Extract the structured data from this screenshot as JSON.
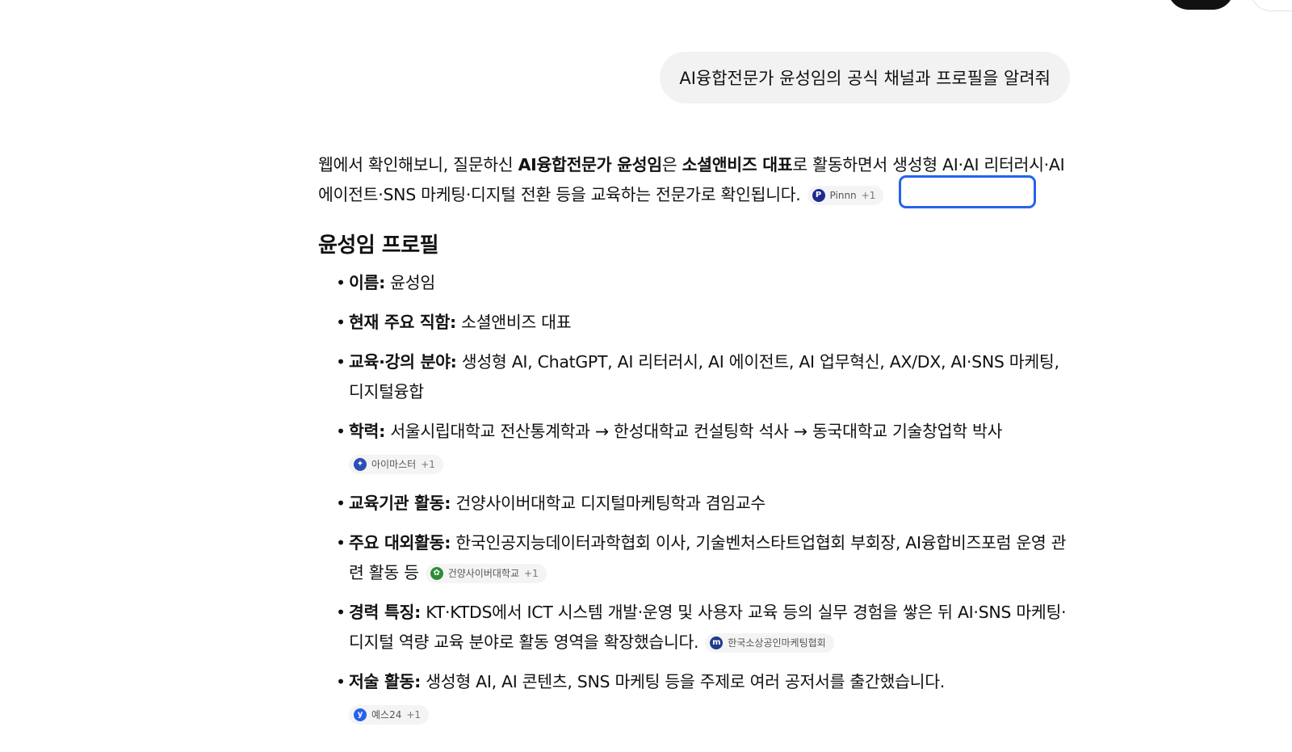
{
  "user_message": "AI융합전문가 윤성임의 공식 채널과 프로필을 알려줘",
  "intro": {
    "part1": "웹에서 확인해보니, 질문하신 ",
    "bold1": "AI융합전문가 윤성임",
    "part2": "은 ",
    "bold2": "소셜앤비즈 대표",
    "part3": "로 활동하면서 생성형 AI·AI 리터러시·AI 에이전트·SNS 마케팅·디지털 전환 등을 교육하는 전문가로 확인됩니다.",
    "citation": {
      "name": "Pinnn",
      "more": "+1",
      "icon_letter": "P",
      "color": "#1f2a8c"
    }
  },
  "section_title": "윤성임 프로필",
  "items": [
    {
      "label": "이름:",
      "text": " 윤성임"
    },
    {
      "label": "현재 주요 직함:",
      "text": " 소셜앤비즈 대표"
    },
    {
      "label": "교육·강의 분야:",
      "text": " 생성형 AI, ChatGPT, AI 리터러시, AI 에이전트, AI 업무혁신, AX/DX, AI·SNS 마케팅, 디지털융합"
    },
    {
      "label": "학력:",
      "text": " 서울시립대학교 전산통계학과 → 한성대학교 컨설팅학 석사 → 동국대학교 기술창업학 박사",
      "citation": {
        "name": "아이마스터",
        "more": "+1",
        "icon_letter": "✦",
        "color": "#2b4fb5"
      },
      "citation_newline": true
    },
    {
      "label": "교육기관 활동:",
      "text": " 건양사이버대학교 디지털마케팅학과 겸임교수"
    },
    {
      "label": "주요 대외활동:",
      "text": " 한국인공지능데이터과학협회 이사, 기술벤처스타트업협회 부회장, AI융합비즈포럼 운영 관련 활동 등",
      "citation": {
        "name": "건양사이버대학교",
        "more": "+1",
        "icon_letter": "✿",
        "color": "#2e8b3a"
      }
    },
    {
      "label": "경력 특징:",
      "text": " KT·KTDS에서 ICT 시스템 개발·운영 및 사용자 교육 등의 실무 경험을 쌓은 뒤 AI·SNS 마케팅·디지털 역량 교육 분야로 활동 영역을 확장했습니다.",
      "citation": {
        "name": "한국소상공인마케팅협회",
        "more": "",
        "icon_letter": "m",
        "color": "#1e3a8a"
      }
    },
    {
      "label": "저술 활동:",
      "text": " 생성형 AI, AI 콘텐츠, SNS 마케팅 등을 주제로 여러 공저서를 출간했습니다.",
      "citation": {
        "name": "예스24",
        "more": "+1",
        "icon_letter": "y",
        "color": "#2563eb"
      },
      "citation_newline": true
    }
  ]
}
